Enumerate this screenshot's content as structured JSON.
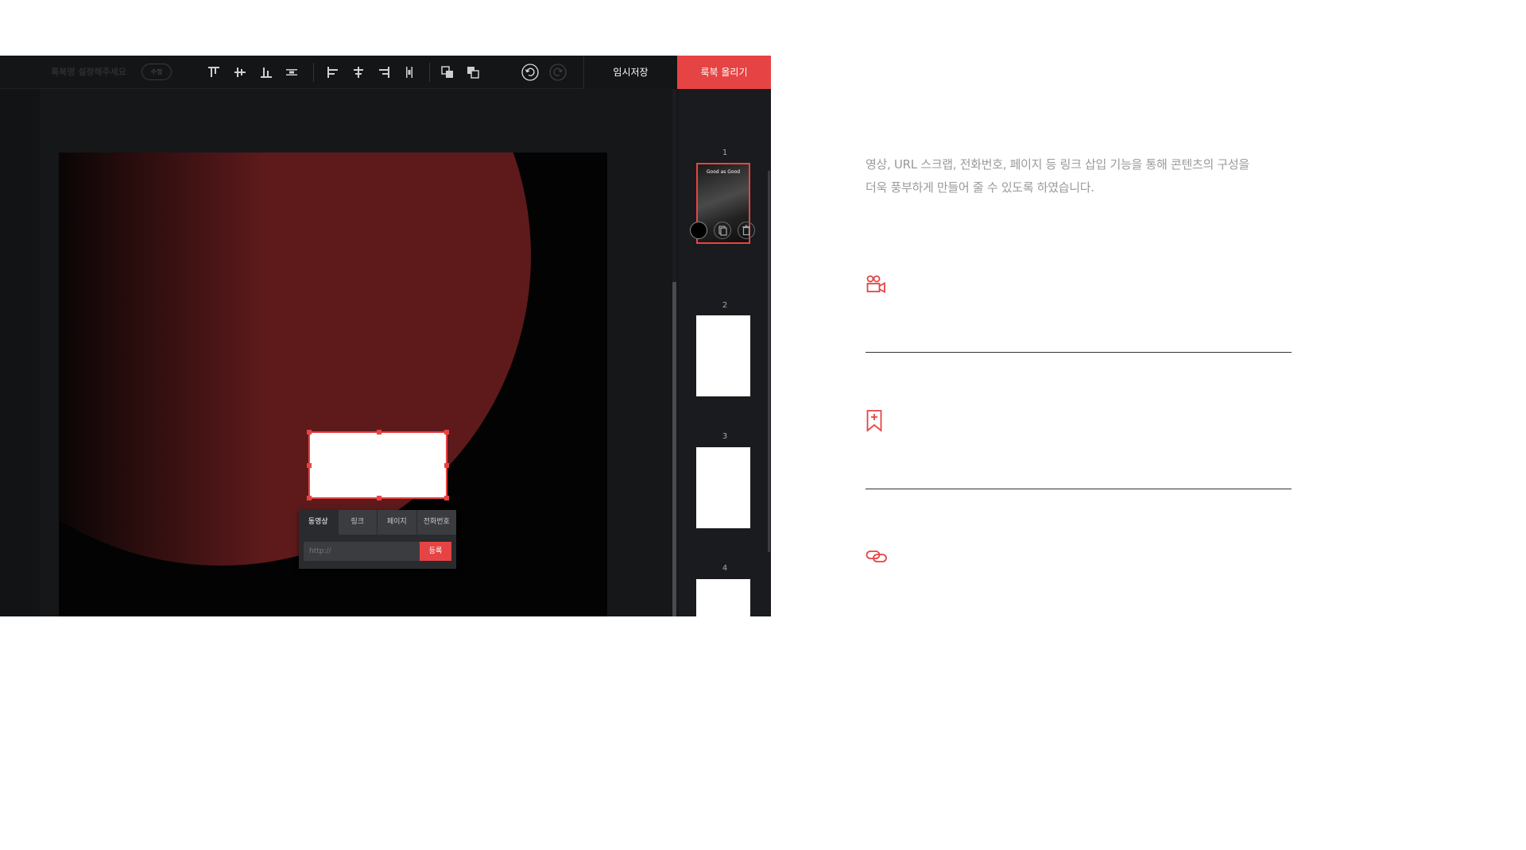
{
  "topbar": {
    "book_name": "룩북명 설정해주세요",
    "edit_label": "수정",
    "save_label": "임시저장",
    "publish_label": "룩북 올리기"
  },
  "link_popup": {
    "tabs": [
      {
        "label": "동영상"
      },
      {
        "label": "링크"
      },
      {
        "label": "페이지"
      },
      {
        "label": "전화번호"
      }
    ],
    "url_placeholder": "http://",
    "register_label": "등록"
  },
  "pages": [
    {
      "number": "1",
      "title": "Good as Good"
    },
    {
      "number": "2"
    },
    {
      "number": "3"
    },
    {
      "number": "4"
    }
  ],
  "description": {
    "line1": "영상, URL 스크랩, 전화번호, 페이지 등 링크 삽입 기능을 통해 콘텐츠의 구성을",
    "line2": "더욱 풍부하게 만들어 줄 수 있도록 하였습니다."
  },
  "colors": {
    "accent": "#e64444",
    "panel": "#161719",
    "circle": "#5e1a1b"
  },
  "icons": {
    "features": [
      "video-camera-icon",
      "bookmark-add-icon",
      "link-icon"
    ]
  }
}
